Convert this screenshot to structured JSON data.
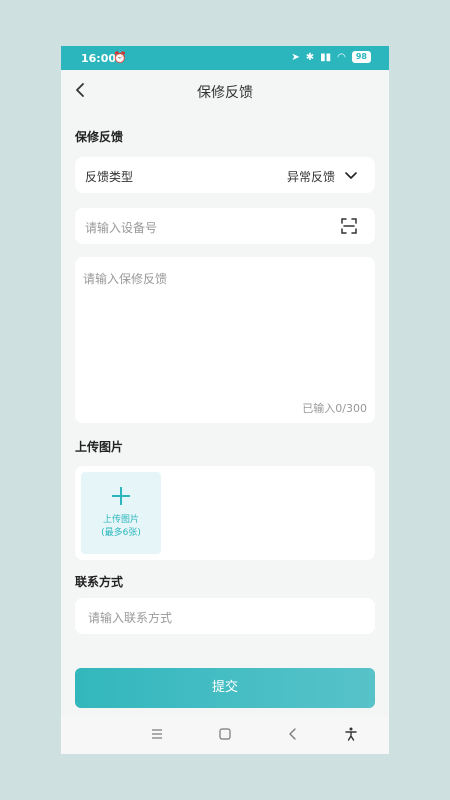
{
  "status_bar": {
    "time": "16:00",
    "battery": "98",
    "icons": [
      "alarm-icon",
      "location-icon",
      "bluetooth-icon",
      "signal-icon",
      "wifi-icon",
      "battery-icon"
    ]
  },
  "header": {
    "title": "保修反馈"
  },
  "form": {
    "section_feedback": "保修反馈",
    "type_label": "反馈类型",
    "type_value": "异常反馈",
    "device_placeholder": "请输入设备号",
    "feedback_placeholder": "请输入保修反馈",
    "char_count": "已输入0/300",
    "section_upload": "上传图片",
    "upload_label": "上传图片",
    "upload_hint": "(最多6张)",
    "section_contact": "联系方式",
    "contact_placeholder": "请输入联系方式",
    "submit_label": "提交"
  },
  "colors": {
    "accent": "#2bb6bd",
    "background": "#f4f5f5",
    "page_bg": "#cfe0e1"
  },
  "nav": {
    "icons": [
      "menu-icon",
      "home-icon",
      "back-icon",
      "accessibility-icon"
    ]
  }
}
